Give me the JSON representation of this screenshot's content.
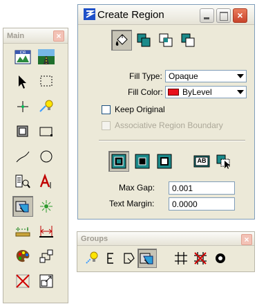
{
  "main_palette": {
    "title": "Main",
    "close_glyph": "×",
    "tools": [
      {
        "icon": "element-selection-sheet-icon"
      },
      {
        "icon": "road-fence-icon"
      },
      {
        "icon": "select-arrow-icon"
      },
      {
        "icon": "dashed-select-box-icon"
      },
      {
        "icon": "place-point-icon"
      },
      {
        "icon": "measure-bulb-icon"
      },
      {
        "icon": "fill-area-icon"
      },
      {
        "icon": "rectangle-icon"
      },
      {
        "icon": "arc-icon"
      },
      {
        "icon": "circle-icon"
      },
      {
        "icon": "text-tag-icon"
      },
      {
        "icon": "place-text-icon"
      },
      {
        "icon": "create-region-icon",
        "selected": true
      },
      {
        "icon": "target-snap-icon"
      },
      {
        "icon": "dimension-icon"
      },
      {
        "icon": "dimension-span-icon"
      },
      {
        "icon": "palette-icon"
      },
      {
        "icon": "hierarchy-icon"
      },
      {
        "icon": "delete-element-icon"
      },
      {
        "icon": "scale-element-icon"
      }
    ]
  },
  "create_region": {
    "title": "Create Region",
    "close_glyph": "×",
    "fill_type_label": "Fill Type:",
    "fill_type_value": "Opaque",
    "fill_color_label": "Fill Color:",
    "fill_color_value": "ByLevel",
    "fill_color_hex": "#e8101c",
    "keep_original_label": "Keep Original",
    "associative_label": "Associative Region Boundary",
    "max_gap_label": "Max Gap:",
    "max_gap_value": "0.001",
    "text_margin_label": "Text Margin:",
    "text_margin_value": "0.0000",
    "text_button_label": "AB"
  },
  "groups_palette": {
    "title": "Groups",
    "close_glyph": "×"
  }
}
